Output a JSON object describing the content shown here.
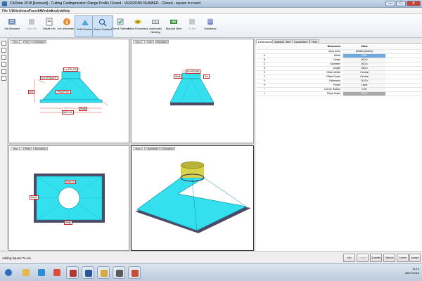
{
  "window": {
    "title": "CADstar 2018 [licensed] - Cutting Cadimpression Flange     Profile Closed - VERSIONS NUMBER - Closed - square to round",
    "minimize": "—",
    "maximize": "□",
    "close": "✕"
  },
  "menu": [
    "File",
    "Utilities",
    "Import",
    "Transfer",
    "Window",
    "Analysis",
    "Help"
  ],
  "toolbar": [
    {
      "label": "Job Browser",
      "icon": "job-browser-icon",
      "state": "normal"
    },
    {
      "label": "Jobs list",
      "icon": "jobs-list-icon",
      "state": "disabled"
    },
    {
      "label": "Detail info",
      "icon": "detail-info-icon",
      "state": "normal"
    },
    {
      "label": "Job Information",
      "icon": "job-information-icon",
      "state": "normal"
    },
    {
      "label": "Edit Contour",
      "icon": "edit-contour-icon",
      "state": "active"
    },
    {
      "label": "Zoom Custom",
      "icon": "zoom-custom-icon",
      "state": "active"
    },
    {
      "label": "Check Takeoff",
      "icon": "check-takeoff-icon",
      "state": "normal"
    },
    {
      "label": "Inline Processes",
      "icon": "inline-processes-icon",
      "state": "normal"
    },
    {
      "label": "Automatic Nesting",
      "icon": "automatic-nesting-icon",
      "state": "normal"
    },
    {
      "label": "Manual Nest",
      "icon": "manual-nest-icon",
      "state": "normal"
    },
    {
      "label": "To file",
      "icon": "to-file-icon",
      "state": "disabled"
    },
    {
      "label": "Database",
      "icon": "database-icon",
      "state": "normal"
    }
  ],
  "viewports": {
    "top_left": {
      "tabs": [
        "View 1",
        "Top",
        "Elevation"
      ]
    },
    "top_right": {
      "tabs": [
        "View 2",
        "Top",
        "Elevation"
      ]
    },
    "bottom_left": {
      "tabs": [
        "View 3",
        "Plan",
        "Elevation"
      ]
    },
    "bottom_right": {
      "tabs": [
        "View 4",
        "Isometric",
        "Elevation"
      ]
    }
  },
  "panel": {
    "tabs": [
      "Dimensions",
      "Options",
      "Item",
      "Connectors",
      "Help"
    ],
    "header": {
      "dimension": "Dimension",
      "value": "Value"
    },
    "subheader": {
      "dimension": "Input Units",
      "value": "Default (Metric)"
    },
    "rows": [
      {
        "idx": "A",
        "label": "Width",
        "value": "1200",
        "style": "hl"
      },
      {
        "idx": "B",
        "label": "Depth",
        "value": "400.0",
        "style": ""
      },
      {
        "idx": "C",
        "label": "Diameter",
        "value": "200.0",
        "style": ""
      },
      {
        "idx": "D",
        "label": "Length",
        "value": "250.0",
        "style": ""
      },
      {
        "idx": "E",
        "label": "Offset Width",
        "value": "Central",
        "style": ""
      },
      {
        "idx": "F",
        "label": "Offset Depth",
        "value": "Central",
        "style": ""
      },
      {
        "idx": "G",
        "label": "Extension",
        "value": "20.00",
        "style": ""
      },
      {
        "idx": "H",
        "label": "Profile",
        "value": "Level",
        "style": ""
      },
      {
        "idx": "I",
        "label": "Corner Radius",
        "value": "0.00",
        "style": ""
      },
      {
        "idx": "J",
        "label": "Slope Angle",
        "value": "45.00",
        "style": "gray"
      }
    ]
  },
  "status": {
    "text": "Adding Square To.ces",
    "buttons": [
      {
        "label": "Info",
        "dim": false
      },
      {
        "label": "Delete",
        "dim": true
      },
      {
        "label": "Quantity",
        "dim": false
      },
      {
        "label": "Options",
        "dim": false
      },
      {
        "label": "Cancel",
        "dim": false
      },
      {
        "label": "Accept",
        "dim": false
      }
    ]
  },
  "taskbar": {
    "apps": [
      {
        "icon": "start-orb-icon",
        "color": "#2e6bbd"
      },
      {
        "icon": "explorer-icon",
        "color": "#e4b84a"
      },
      {
        "icon": "ie-icon",
        "color": "#2b8cd8"
      },
      {
        "icon": "chrome-icon",
        "color": "#d94d3a"
      },
      {
        "icon": "cad-app-icon",
        "color": "#b23a32"
      },
      {
        "icon": "word-icon",
        "color": "#2a5699"
      },
      {
        "icon": "folder-icon",
        "color": "#d8a93c"
      },
      {
        "icon": "media-icon",
        "color": "#5b5b5b"
      },
      {
        "icon": "user-app-icon",
        "color": "#c94c35"
      }
    ],
    "clock_time": "11:10",
    "clock_date": "06/07/2018"
  },
  "colors": {
    "duct": "#35e0ee",
    "duct_dark": "#12b6c8",
    "flange": "#4e4a66",
    "collar": "#d8d34a",
    "dim_red": "#cc2222"
  },
  "dim_labels": {
    "tl": {
      "top": "Lo-FPLATE",
      "left": "Ext STRAIGHT",
      "mid": "TRIALPOLE",
      "side": "Ext",
      "bottom": "Width",
      "bottom2": "800.0-04"
    },
    "tr": {
      "top": "Ext ROUND",
      "left": "Width",
      "right": "Ext"
    },
    "bl": {
      "circle": "Diam-10",
      "left": "Depth",
      "bottom": "Width"
    }
  }
}
